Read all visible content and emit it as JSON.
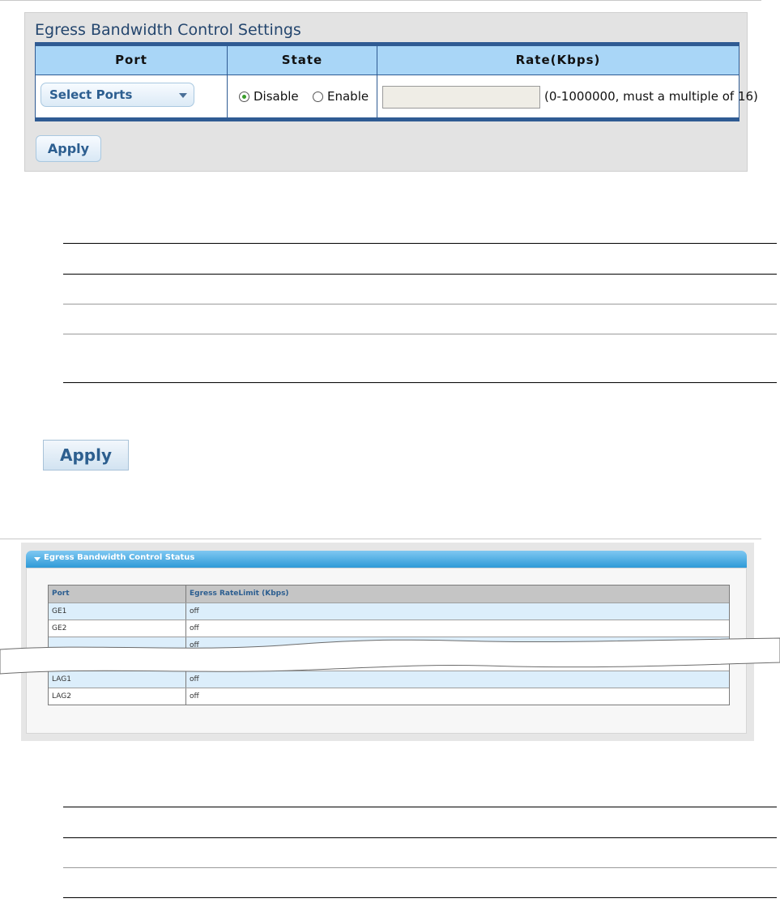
{
  "settings": {
    "title": "Egress Bandwidth Control Settings",
    "columns": {
      "port": "Port",
      "state": "State",
      "rate": "Rate(Kbps)"
    },
    "select_ports_label": "Select Ports",
    "state_options": {
      "disable": "Disable",
      "enable": "Enable",
      "selected": "Disable"
    },
    "rate_value": "",
    "rate_hint": "(0-1000000, must a multiple of 16)",
    "apply_label": "Apply"
  },
  "description": {
    "apply_label": "Apply"
  },
  "status": {
    "title": "Egress Bandwidth Control Status",
    "columns": {
      "port": "Port",
      "limit": "Egress RateLimit (Kbps)"
    },
    "rows": [
      {
        "port": "GE1",
        "limit": "off"
      },
      {
        "port": "GE2",
        "limit": "off"
      },
      {
        "port": "",
        "limit": "off"
      },
      {
        "port": "",
        "limit": ""
      },
      {
        "port": "LAG1",
        "limit": "off"
      },
      {
        "port": "LAG2",
        "limit": "off"
      }
    ]
  },
  "colors": {
    "accent": "#2f5b93",
    "header_blue": "#a9d6f7",
    "status_header": "#2f9ad7"
  }
}
